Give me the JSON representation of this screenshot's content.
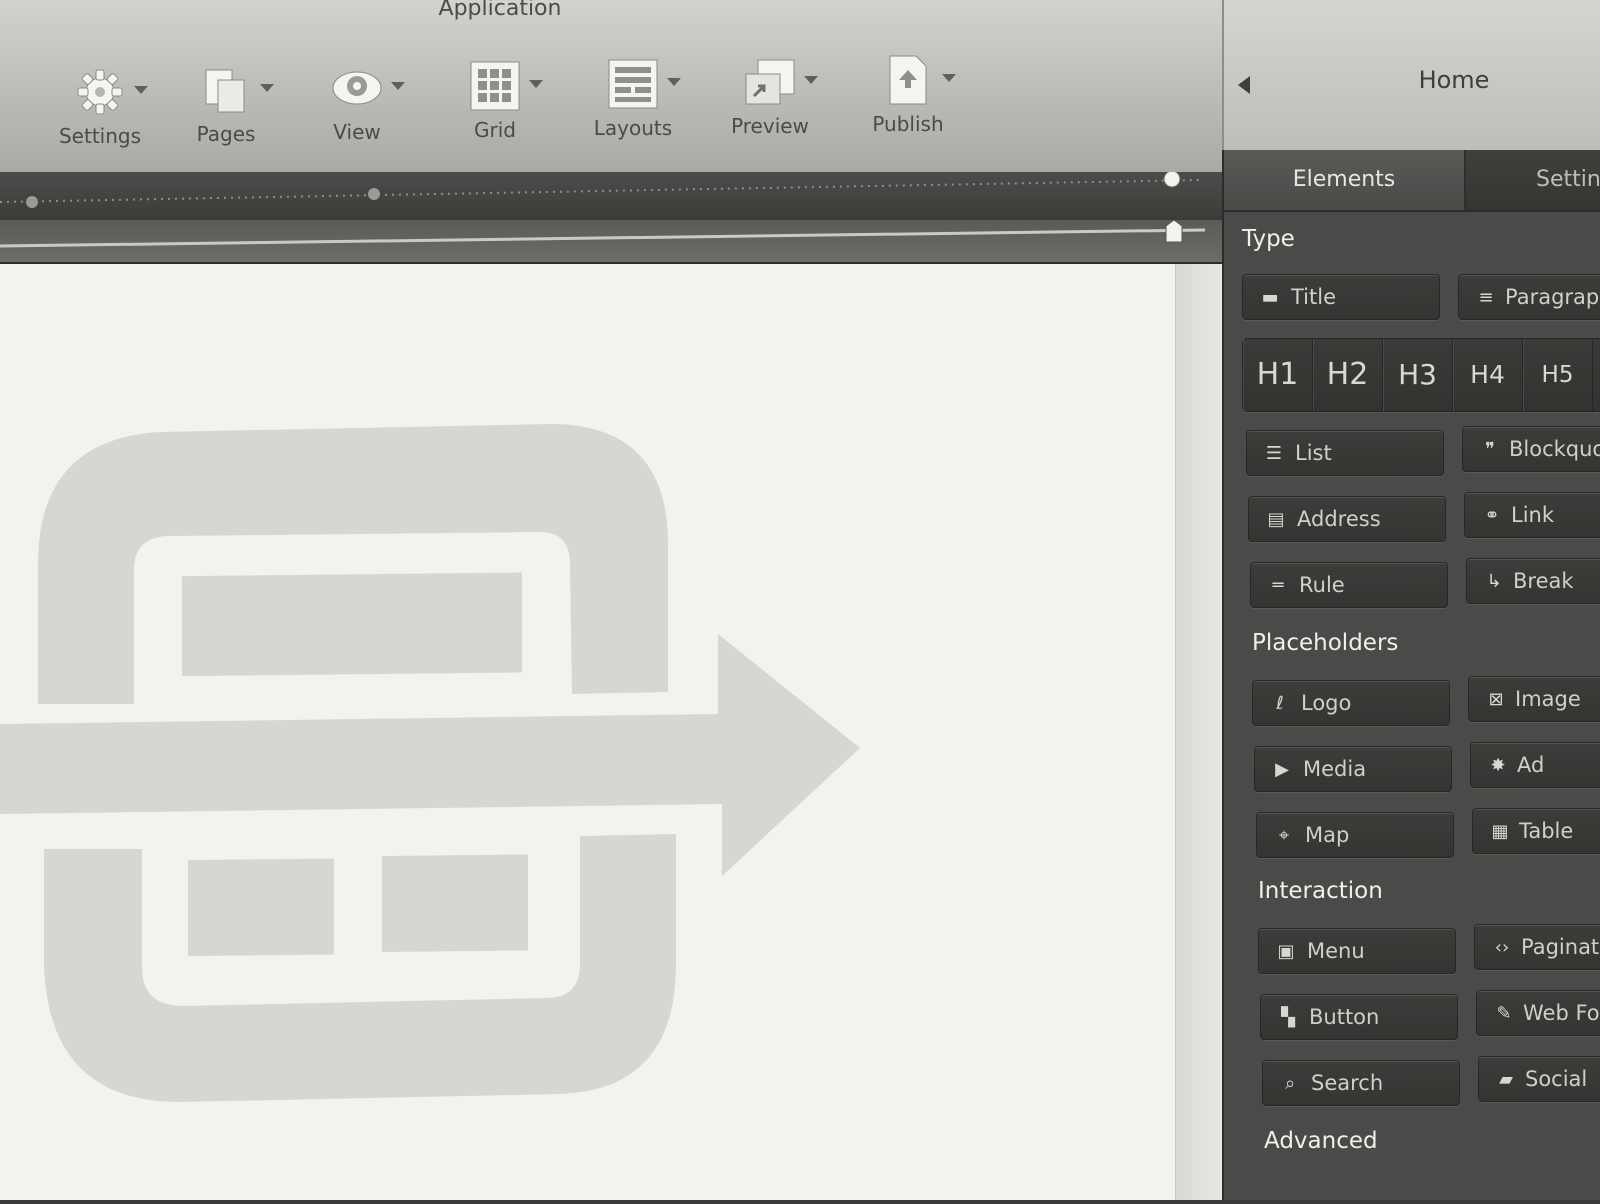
{
  "app": {
    "title": "Application"
  },
  "toolbar": {
    "items": [
      {
        "label": "Settings",
        "icon": "gear-icon"
      },
      {
        "label": "Pages",
        "icon": "pages-icon"
      },
      {
        "label": "View",
        "icon": "eye-icon"
      },
      {
        "label": "Grid",
        "icon": "grid-icon"
      },
      {
        "label": "Layouts",
        "icon": "layouts-icon"
      },
      {
        "label": "Preview",
        "icon": "preview-icon"
      },
      {
        "label": "Publish",
        "icon": "publish-icon"
      }
    ]
  },
  "panel": {
    "title": "Home",
    "tabs": [
      {
        "label": "Elements"
      },
      {
        "label": "Settin"
      }
    ],
    "sections": {
      "type": {
        "heading": "Type",
        "title_btn": "Title",
        "paragraph_btn": "Paragrapl",
        "headings": [
          "H1",
          "H2",
          "H3",
          "H4",
          "H5"
        ],
        "list_btn": "List",
        "blockquote_btn": "Blockquo",
        "address_btn": "Address",
        "link_btn": "Link",
        "rule_btn": "Rule",
        "break_btn": "Break"
      },
      "placeholders": {
        "heading": "Placeholders",
        "logo_btn": "Logo",
        "image_btn": "Image",
        "media_btn": "Media",
        "ad_btn": "Ad",
        "map_btn": "Map",
        "table_btn": "Table"
      },
      "interaction": {
        "heading": "Interaction",
        "menu_btn": "Menu",
        "pagination_btn": "Paginati",
        "button_btn": "Button",
        "webform_btn": "Web Fo",
        "search_btn": "Search",
        "social_btn": "Social"
      },
      "advanced": {
        "heading": "Advanced"
      }
    }
  },
  "colors": {
    "toolbar_bg": "#c2c3bf",
    "panel_bg": "#4a4b48",
    "canvas_bg": "#f2f2ee",
    "logo_gray": "#d4d4d0"
  }
}
